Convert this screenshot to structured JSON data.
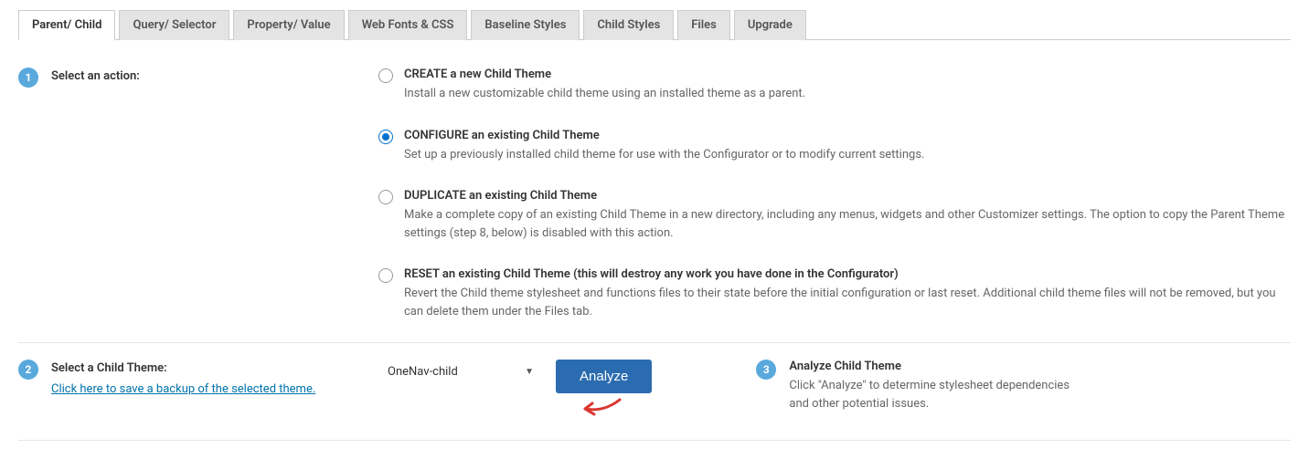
{
  "tabs": {
    "items": [
      {
        "label": "Parent/ Child",
        "active": true
      },
      {
        "label": "Query/ Selector",
        "active": false
      },
      {
        "label": "Property/ Value",
        "active": false
      },
      {
        "label": "Web Fonts & CSS",
        "active": false
      },
      {
        "label": "Baseline Styles",
        "active": false
      },
      {
        "label": "Child Styles",
        "active": false
      },
      {
        "label": "Files",
        "active": false
      },
      {
        "label": "Upgrade",
        "active": false
      }
    ]
  },
  "step1": {
    "number": "1",
    "label": "Select an action:",
    "options": [
      {
        "title": "CREATE a new Child Theme",
        "desc": "Install a new customizable child theme using an installed theme as a parent.",
        "selected": false
      },
      {
        "title": "CONFIGURE an existing Child Theme",
        "desc": "Set up a previously installed child theme for use with the Configurator or to modify current settings.",
        "selected": true
      },
      {
        "title": "DUPLICATE an existing Child Theme",
        "desc": "Make a complete copy of an existing Child Theme in a new directory, including any menus, widgets and other Customizer settings. The option to copy the Parent Theme settings (step 8, below) is disabled with this action.",
        "selected": false
      },
      {
        "title": "RESET an existing Child Theme (this will destroy any work you have done in the Configurator)",
        "desc": "Revert the Child theme stylesheet and functions files to their state before the initial configuration or last reset. Additional child theme files will not be removed, but you can delete them under the Files tab.",
        "selected": false
      }
    ]
  },
  "step2": {
    "number": "2",
    "label": "Select a Child Theme:",
    "backup_link": "Click here to save a backup of the selected theme.",
    "selected_theme": "OneNav-child",
    "analyze_button": "Analyze"
  },
  "step3": {
    "number": "3",
    "title": "Analyze Child Theme",
    "desc": "Click \"Analyze\" to determine stylesheet dependencies and other potential issues."
  }
}
